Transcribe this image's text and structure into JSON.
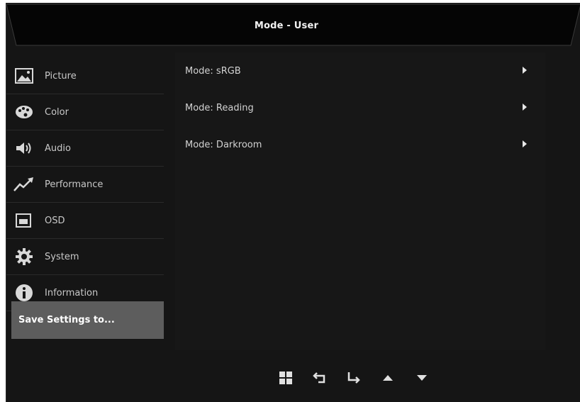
{
  "header": {
    "title": "Mode - User"
  },
  "sidebar": {
    "items": [
      {
        "label": "Picture",
        "icon": "picture-icon"
      },
      {
        "label": "Color",
        "icon": "palette-icon"
      },
      {
        "label": "Audio",
        "icon": "speaker-icon"
      },
      {
        "label": "Performance",
        "icon": "performance-icon"
      },
      {
        "label": "OSD",
        "icon": "osd-icon"
      },
      {
        "label": "System",
        "icon": "gear-icon"
      },
      {
        "label": "Information",
        "icon": "info-icon"
      }
    ],
    "save_label": "Save Settings to..."
  },
  "main": {
    "modes": [
      {
        "label": "Mode: sRGB"
      },
      {
        "label": "Mode: Reading"
      },
      {
        "label": "Mode: Darkroom"
      }
    ]
  },
  "footer": {
    "buttons": [
      "menu-icon",
      "back-icon",
      "enter-icon",
      "up-icon",
      "down-icon"
    ]
  },
  "colors": {
    "background": "#151515",
    "selected": "#5d5d5d",
    "text": "#c8c8c8"
  }
}
